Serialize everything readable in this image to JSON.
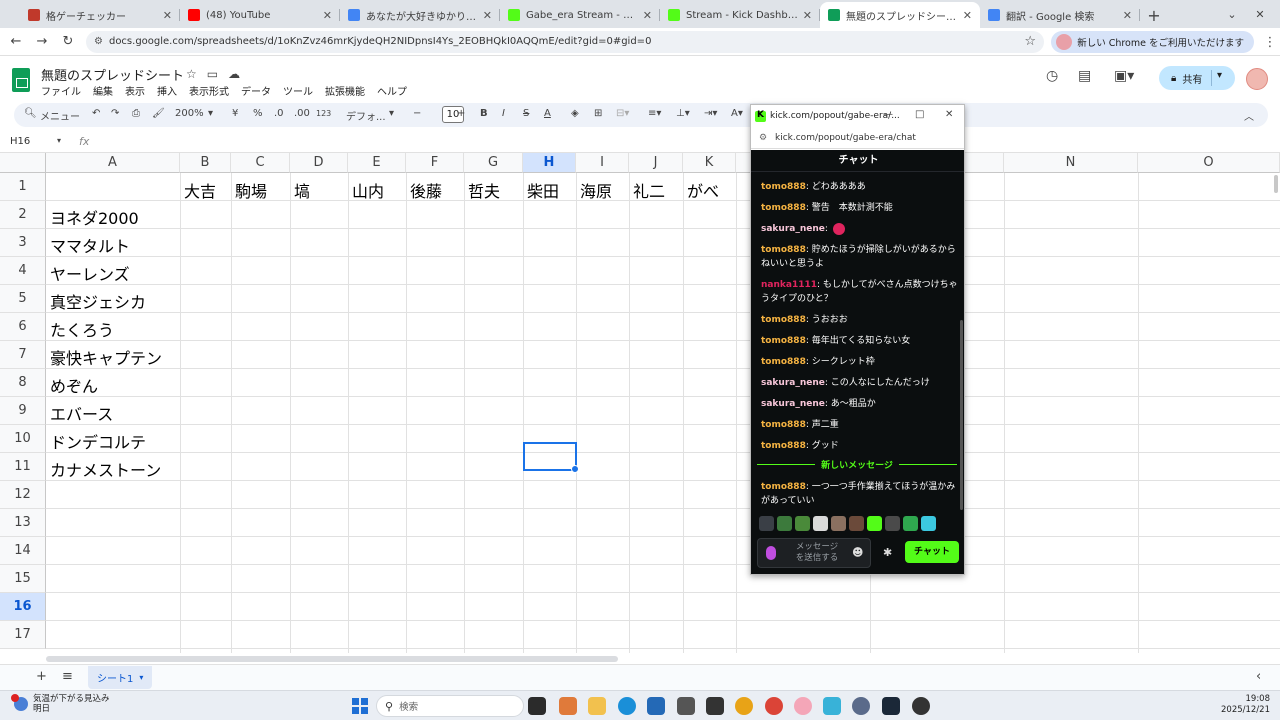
{
  "browser": {
    "tabs": [
      {
        "title": "格ゲーチェッカー",
        "favicon_color": "#c0392b",
        "active": false
      },
      {
        "title": "(48) YouTube",
        "favicon_color": "#ff0000",
        "active": false
      },
      {
        "title": "あなたが大好きゆかりちゃんーばん",
        "favicon_color": "#4285f4",
        "active": false
      },
      {
        "title": "Gabe_era Stream - Watch Live",
        "favicon_color": "#53fc18",
        "active": false
      },
      {
        "title": "Stream - Kick Dashboard",
        "favicon_color": "#53fc18",
        "active": false
      },
      {
        "title": "無題のスプレッドシート - Google ス",
        "favicon_color": "#0f9d58",
        "active": true
      },
      {
        "title": "翻訳 - Google 検索",
        "favicon_color": "#4285f4",
        "active": false
      }
    ],
    "url": "docs.google.com/spreadsheets/d/1oKnZvz46mrKjydeQH2NIDpnsI4Ys_2EOBHQkI0AQQmE/edit?gid=0#gid=0",
    "promo": "新しい Chrome をご利用いただけます"
  },
  "sheets": {
    "title": "無題のスプレッドシート",
    "menu": [
      "ファイル",
      "編集",
      "表示",
      "挿入",
      "表示形式",
      "データ",
      "ツール",
      "拡張機能",
      "ヘルプ"
    ],
    "share_label": "共有",
    "toolbar": {
      "search_label": "メニュー",
      "zoom": "200%",
      "currency": "¥",
      "percent": "%",
      "dec_dec": ".0",
      "dec_inc": ".00",
      "number_format": "123",
      "font": "デフォ...",
      "font_size": "10",
      "bold": "B",
      "italic": "I",
      "strike": "S",
      "text_color": "A"
    },
    "name_box": "H16",
    "fx": "fx",
    "columns": [
      "A",
      "B",
      "C",
      "D",
      "E",
      "F",
      "G",
      "H",
      "I",
      "J",
      "K",
      "L",
      "M",
      "N",
      "O"
    ],
    "rows": [
      "1",
      "2",
      "3",
      "4",
      "5",
      "6",
      "7",
      "8",
      "9",
      "10",
      "11",
      "12",
      "13",
      "14",
      "15",
      "16",
      "17"
    ],
    "header_names": [
      "大吉",
      "駒場",
      "塙",
      "山内",
      "後藤",
      "哲夫",
      "柴田",
      "海原",
      "礼二",
      "がべ"
    ],
    "row_names": [
      "ヨネダ2000",
      "ママタルト",
      "ヤーレンズ",
      "真空ジェシカ",
      "たくろう",
      "豪快キャプテン",
      "めぞん",
      "エバース",
      "ドンデコルテ",
      "カナメストーン"
    ],
    "selected_cell": "H16",
    "sheet_tab": "シート1"
  },
  "popout": {
    "window_title": "kick.com/popout/gabe-era/...",
    "url": "kick.com/popout/gabe-era/chat",
    "chat_header": "チャット",
    "messages": [
      {
        "user": "tomo888",
        "user_color": "#f5b342",
        "text": "どわああああ"
      },
      {
        "user": "tomo888",
        "user_color": "#f5b342",
        "text": "警告　本数計測不能"
      },
      {
        "user": "sakura_nene",
        "user_color": "#f7c6d9",
        "text": "",
        "emote": "fire-emote"
      },
      {
        "user": "tomo888",
        "user_color": "#f5b342",
        "text": "貯めたほうが掃除しがいがあるからねいいと思うよ"
      },
      {
        "user": "nanka1111",
        "user_color": "#e0245e",
        "text": "もしかしてがべさん点数つけちゃうタイプのひと？"
      },
      {
        "user": "tomo888",
        "user_color": "#f5b342",
        "text": "うおおお"
      },
      {
        "user": "tomo888",
        "user_color": "#f5b342",
        "text": "毎年出てくる知らない女"
      },
      {
        "user": "tomo888",
        "user_color": "#f5b342",
        "text": "シークレット枠"
      },
      {
        "user": "sakura_nene",
        "user_color": "#f7c6d9",
        "text": "この人なにしたんだっけ"
      },
      {
        "user": "sakura_nene",
        "user_color": "#f7c6d9",
        "text": "あ〜粗品か"
      },
      {
        "user": "tomo888",
        "user_color": "#f5b342",
        "text": "声二重"
      },
      {
        "user": "tomo888",
        "user_color": "#f5b342",
        "text": "グッド"
      }
    ],
    "new_messages_label": "新しいメッセージ",
    "latest_message": {
      "user": "tomo888",
      "user_color": "#f5b342",
      "text": "一つ一つ手作業揃えてほうが温かみがあっていい"
    },
    "input_placeholder": "メッセージを送信する",
    "send_label": "チャット"
  },
  "taskbar": {
    "weather_text": "気温が下がる見込み",
    "weather_sub": "明日",
    "search_placeholder": "検索",
    "time": "19:08",
    "date": "2025/12/21"
  }
}
